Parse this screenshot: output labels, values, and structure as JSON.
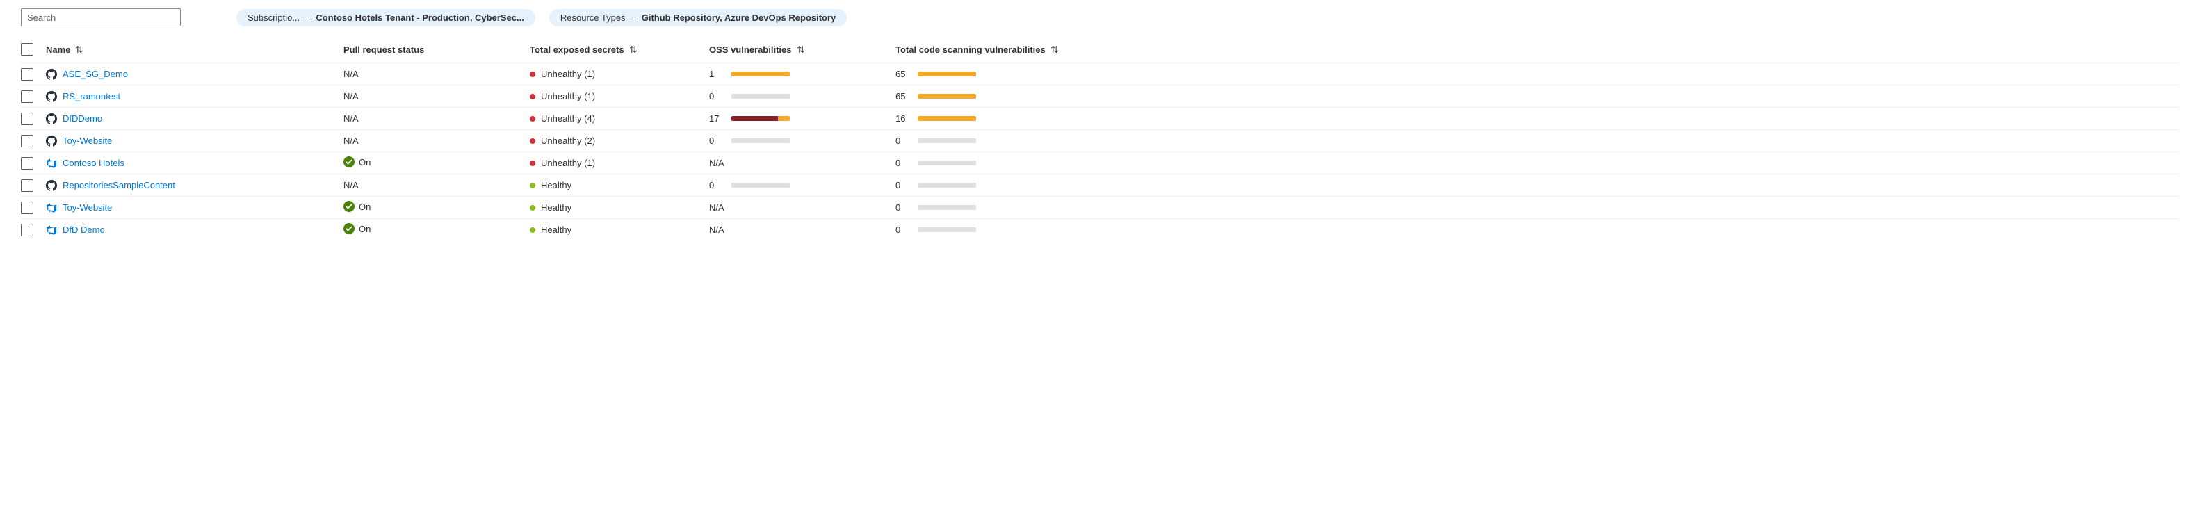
{
  "search": {
    "placeholder": "Search"
  },
  "filters": [
    {
      "key": "Subscriptio...",
      "op": "==",
      "value": "Contoso Hotels Tenant - Production, CyberSec..."
    },
    {
      "key": "Resource Types",
      "op": "==",
      "value": "Github Repository, Azure DevOps Repository"
    }
  ],
  "columns": {
    "name": "Name",
    "pr_status": "Pull request status",
    "secrets": "Total exposed secrets",
    "oss": "OSS vulnerabilities",
    "code": "Total code scanning vulnerabilities"
  },
  "status_labels": {
    "unhealthy": "Unhealthy",
    "healthy": "Healthy"
  },
  "colors": {
    "link": "#0078d4",
    "unhealthy_dot": "#d13438",
    "healthy_dot": "#8cbd18",
    "bar_bg": "#e1dfdd",
    "orange": "#f2a92e",
    "darkred": "#842029",
    "green_check": "#498205"
  },
  "rows": [
    {
      "name": "ASE_SG_Demo",
      "repoType": "github",
      "prStatus": {
        "type": "na",
        "text": "N/A"
      },
      "secrets": {
        "state": "unhealthy",
        "count": 1,
        "text": "Unhealthy (1)"
      },
      "oss": {
        "value": "1",
        "segments": [
          {
            "color": "orange",
            "pct": 100
          }
        ]
      },
      "code": {
        "value": "65",
        "segments": [
          {
            "color": "orange",
            "pct": 100
          }
        ]
      }
    },
    {
      "name": "RS_ramontest",
      "repoType": "github",
      "prStatus": {
        "type": "na",
        "text": "N/A"
      },
      "secrets": {
        "state": "unhealthy",
        "count": 1,
        "text": "Unhealthy (1)"
      },
      "oss": {
        "value": "0",
        "segments": []
      },
      "code": {
        "value": "65",
        "segments": [
          {
            "color": "orange",
            "pct": 100
          }
        ]
      }
    },
    {
      "name": "DfDDemo",
      "repoType": "github",
      "prStatus": {
        "type": "na",
        "text": "N/A"
      },
      "secrets": {
        "state": "unhealthy",
        "count": 4,
        "text": "Unhealthy (4)"
      },
      "oss": {
        "value": "17",
        "segments": [
          {
            "color": "darkred",
            "pct": 80
          },
          {
            "color": "orange",
            "pct": 20
          }
        ]
      },
      "code": {
        "value": "16",
        "segments": [
          {
            "color": "orange",
            "pct": 100
          }
        ]
      }
    },
    {
      "name": "Toy-Website",
      "repoType": "github",
      "prStatus": {
        "type": "na",
        "text": "N/A"
      },
      "secrets": {
        "state": "unhealthy",
        "count": 2,
        "text": "Unhealthy (2)"
      },
      "oss": {
        "value": "0",
        "segments": []
      },
      "code": {
        "value": "0",
        "segments": []
      }
    },
    {
      "name": "Contoso Hotels",
      "repoType": "azuredevops",
      "prStatus": {
        "type": "on",
        "text": "On"
      },
      "secrets": {
        "state": "unhealthy",
        "count": 1,
        "text": "Unhealthy (1)"
      },
      "oss": {
        "value": "N/A",
        "segments": null
      },
      "code": {
        "value": "0",
        "segments": []
      }
    },
    {
      "name": "RepositoriesSampleContent",
      "repoType": "github",
      "prStatus": {
        "type": "na",
        "text": "N/A"
      },
      "secrets": {
        "state": "healthy",
        "count": 0,
        "text": "Healthy"
      },
      "oss": {
        "value": "0",
        "segments": []
      },
      "code": {
        "value": "0",
        "segments": []
      }
    },
    {
      "name": "Toy-Website",
      "repoType": "azuredevops",
      "prStatus": {
        "type": "on",
        "text": "On"
      },
      "secrets": {
        "state": "healthy",
        "count": 0,
        "text": "Healthy"
      },
      "oss": {
        "value": "N/A",
        "segments": null
      },
      "code": {
        "value": "0",
        "segments": []
      }
    },
    {
      "name": "DfD Demo",
      "repoType": "azuredevops",
      "prStatus": {
        "type": "on",
        "text": "On"
      },
      "secrets": {
        "state": "healthy",
        "count": 0,
        "text": "Healthy"
      },
      "oss": {
        "value": "N/A",
        "segments": null
      },
      "code": {
        "value": "0",
        "segments": []
      }
    }
  ]
}
